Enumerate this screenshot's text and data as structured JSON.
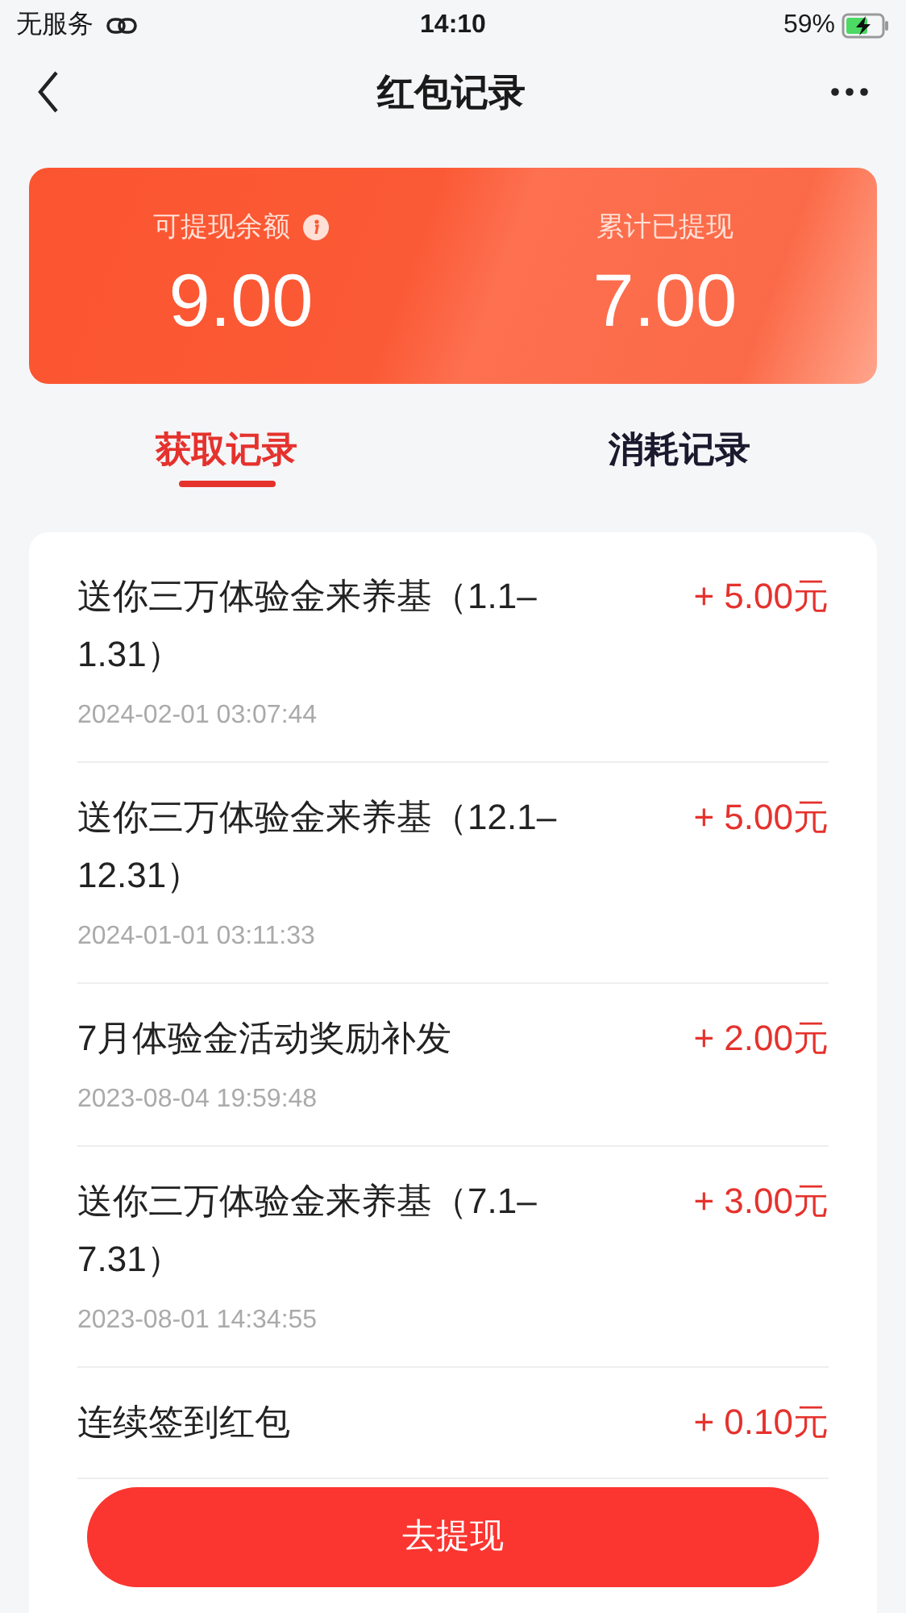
{
  "status_bar": {
    "carrier": "无服务",
    "time": "14:10",
    "battery": "59%"
  },
  "nav": {
    "title": "红包记录"
  },
  "summary": [
    {
      "label": "可提现余额",
      "info": true,
      "value": "9.00"
    },
    {
      "label": "累计已提现",
      "info": false,
      "value": "7.00"
    }
  ],
  "tabs": [
    {
      "label": "获取记录",
      "selected": true
    },
    {
      "label": "消耗记录",
      "selected": false
    }
  ],
  "records": [
    {
      "title": "送你三万体验金来养基（1.1–1.31）",
      "amount": "+ 5.00元",
      "time": "2024-02-01 03:07:44"
    },
    {
      "title": "送你三万体验金来养基（12.1–12.31）",
      "amount": "+ 5.00元",
      "time": "2024-01-01 03:11:33"
    },
    {
      "title": "7月体验金活动奖励补发",
      "amount": "+ 2.00元",
      "time": "2023-08-04 19:59:48"
    },
    {
      "title": "送你三万体验金来养基（7.1–7.31）",
      "amount": "+ 3.00元",
      "time": "2023-08-01 14:34:55"
    },
    {
      "title": "连续签到红包",
      "amount": "+ 0.10元"
    }
  ],
  "button": "去提现"
}
